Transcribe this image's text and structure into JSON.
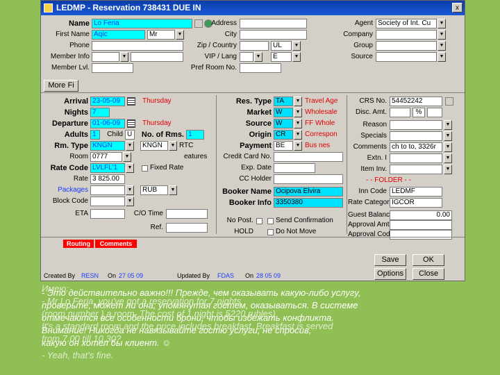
{
  "window": {
    "title": "LEDMP - Reservation 738431 DUE IN",
    "close": "x"
  },
  "guest": {
    "name_label": "Name",
    "name_value": "Lo Feria",
    "first_label": "First Name",
    "first_value": "Aqic",
    "title_value": "Mr",
    "phone_label": "Phone",
    "member_info_label": "Member Info",
    "member_lvl_label": "Member Lvl.",
    "address_label": "Address",
    "city_label": "City",
    "zip_label": "Zip / Country",
    "country_value": "UL",
    "vip_label": "VIP / Lang",
    "lang_value": "E",
    "pref_room_label": "Pref Room No.",
    "agent_label": "Agent",
    "agent_value": "Society of Int. Cu",
    "company_label": "Company",
    "group_label": "Group",
    "source_label": "Source",
    "more_button": "More Fi"
  },
  "stay": {
    "arrival_label": "Arrival",
    "arrival_value": "23-05-09",
    "arrival_day": "Thursday",
    "nights_label": "Nights",
    "nights_value": "7",
    "departure_label": "Departure",
    "departure_value": "01-06-09",
    "departure_day": "Thursday",
    "adults_label": "Adults",
    "adults_value": "1",
    "child_label": "Child",
    "child_value": "U",
    "rms_label": "No. of Rms.",
    "rms_value": "1",
    "rmtype_label": "Rm. Type",
    "rmtype_value": "KNGN",
    "rmtype2_value": "KNGN",
    "rtc_label": "RTC",
    "room_label": "Room",
    "room_value": "0777",
    "features_label": "eatures",
    "ratecode_label": "Rate Code",
    "ratecode_value": "LVLFL'1",
    "fixed_rate_label": "Fixed Rate",
    "rate_label": "Rate",
    "rate_value": "3 825.00",
    "packages_label": "Packages",
    "currency_value": "RUB",
    "block_label": "Block Code",
    "eta_label": "ETA",
    "co_time_label": "C/O Time",
    "ref_label": "Ref."
  },
  "res": {
    "restype_label": "Res. Type",
    "restype_value": "TA",
    "restype_text": "Travel Age",
    "market_label": "Market",
    "market_value": "W",
    "market_text": "Wholesale",
    "source_label": "Source",
    "source_value": "W",
    "source_text": "FF Whole",
    "origin_label": "Origin",
    "origin_value": "CR",
    "origin_text": "Correspon",
    "payment_label": "Payment",
    "payment_value": "BE",
    "payment_text": "Bus nes",
    "cc_label": "Credit Card No.",
    "exp_label": "Exp. Date",
    "cc_holder_label": "CC Holder",
    "booker_name_label": "Booker Name",
    "booker_name_value": "Ocipova Elvira",
    "booker_info_label": "Booker Info",
    "booker_info_value": "3350380",
    "no_post_label": "No Post.",
    "send_conf_label": "Send Confirmation",
    "hold_label": "HOLD",
    "dnm_label": "Do Not Move"
  },
  "right": {
    "crs_label": "CRS No.",
    "crs_value": "54452242",
    "disc_label": "Disc. Amt.",
    "disc_pct": "%",
    "reason_label": "Reason",
    "specials_label": "Specials",
    "comments_label": "Comments",
    "comments_value": "ch to to, 3326r",
    "extn_label": "Extn. I",
    "item_label": "Item Inv.",
    "folder_header": "- - FOLDER - -",
    "inn_label": "Inn Code",
    "inn_value": "LEDMF",
    "rate_cat_label": "Rate Category",
    "rate_cat_value": "IGCOR",
    "balance_label": "Guest Balance",
    "balance_value": "0.00",
    "approval_amt_label": "Approval Amt.",
    "approval_code_label": "Approval Code"
  },
  "buttons": {
    "routing": "Routing",
    "comments": "Comments",
    "save": "Save",
    "ok": "OK",
    "options": "Options",
    "close": "Close"
  },
  "footer": {
    "created_label": "Created By",
    "created_by": "RESN",
    "created_on_label": "On",
    "created_on": "27 05 09",
    "updated_label": "Updated By",
    "updated_by": "FDAS",
    "updated_on_label": "On",
    "updated_on": "28 05 09"
  },
  "overlay": {
    "ru": [
      "- Это действительно важно!!! Прежде, чем оказывать какую-либо услугу,",
      "  проверьте, может ли она, упомянутая гостем, оказываться. В системе",
      "  отмечаются все особенности брони, чтобы избежать конфликта.",
      "  Внимание! Никогда не навязывайте гостю услуги, не спросив,",
      "  какую он хотел бы клиент. ☺"
    ],
    "en": [
      "Имею:",
      "- Mr Lo Feria, you've got a reservation for 7 nights",
      "  (room number ) a room. The cost of 1 night is 5220 rubles)",
      "  It's a standard room and the price includes breakfast. Breakfast is served",
      "  from 7.00 till 10.30?",
      "- Yeah, that's fine."
    ]
  }
}
